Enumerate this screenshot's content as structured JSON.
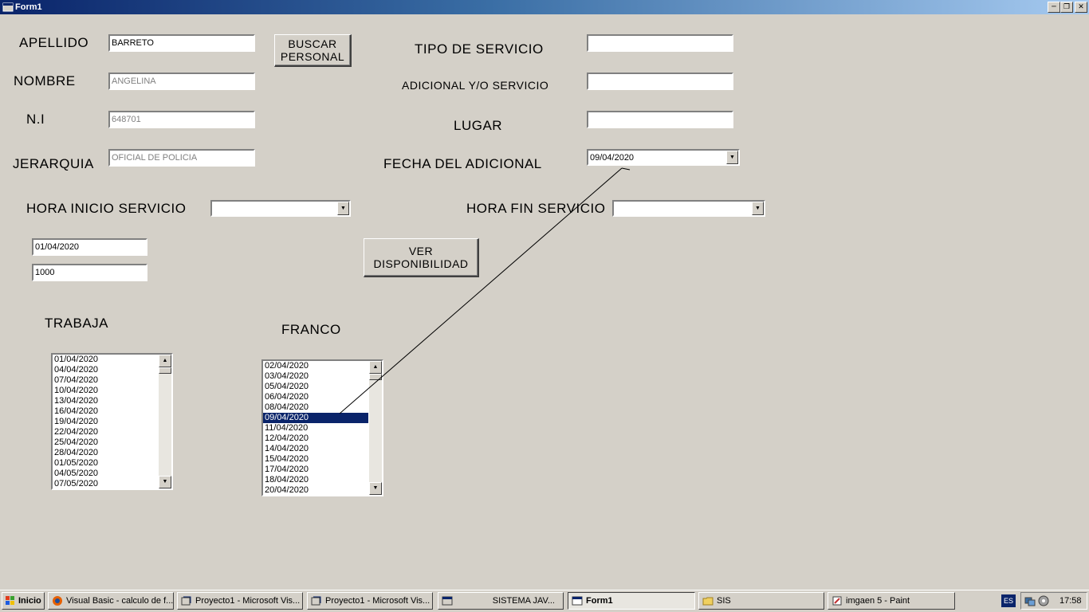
{
  "window": {
    "title": "Form1"
  },
  "form": {
    "apellido_label": "APELLIDO",
    "apellido_value": "BARRETO",
    "nombre_label": "NOMBRE",
    "nombre_value": "ANGELINA",
    "ni_label": "N.I",
    "ni_value": "648701",
    "jerarquia_label": "JERARQUIA",
    "jerarquia_value": "OFICIAL DE POLICIA",
    "buscar_button": "BUSCAR\nPERSONAL",
    "tipo_servicio_label": "TIPO DE SERVICIO",
    "tipo_servicio_value": "",
    "adicional_label": "ADICIONAL Y/O SERVICIO",
    "adicional_value": "",
    "lugar_label": "LUGAR",
    "lugar_value": "",
    "fecha_adicional_label": "FECHA DEL ADICIONAL",
    "fecha_adicional_value": "09/04/2020",
    "hora_inicio_label": "HORA INICIO SERVICIO",
    "hora_inicio_value": "",
    "hora_fin_label": "HORA FIN SERVICIO",
    "hora_fin_value": "",
    "fecha_inicio_value": "01/04/2020",
    "numero_value": "1000",
    "ver_disponibilidad_button": "VER\nDISPONIBILIDAD",
    "trabaja_label": "TRABAJA",
    "franco_label": "FRANCO"
  },
  "trabaja_list": [
    "01/04/2020",
    "04/04/2020",
    "07/04/2020",
    "10/04/2020",
    "13/04/2020",
    "16/04/2020",
    "19/04/2020",
    "22/04/2020",
    "25/04/2020",
    "28/04/2020",
    "01/05/2020",
    "04/05/2020",
    "07/05/2020"
  ],
  "franco_list": [
    "02/04/2020",
    "03/04/2020",
    "05/04/2020",
    "06/04/2020",
    "08/04/2020",
    "09/04/2020",
    "11/04/2020",
    "12/04/2020",
    "14/04/2020",
    "15/04/2020",
    "17/04/2020",
    "18/04/2020",
    "20/04/2020"
  ],
  "franco_selected_index": 5,
  "taskbar": {
    "start": "Inicio",
    "items": [
      {
        "label": "Visual Basic - calculo de f...",
        "icon": "firefox-icon"
      },
      {
        "label": "Proyecto1 - Microsoft Vis...",
        "icon": "vb-icon"
      },
      {
        "label": "Proyecto1 - Microsoft Vis...",
        "icon": "vb-icon"
      },
      {
        "label": "SISTEMA JAV...",
        "icon": "app-icon"
      },
      {
        "label": "Form1",
        "icon": "form-icon"
      },
      {
        "label": "SIS",
        "icon": "folder-icon"
      },
      {
        "label": "imgaen 5 - Paint",
        "icon": "paint-icon"
      }
    ],
    "language": "ES",
    "clock": "17:58"
  },
  "colors": {
    "selection": "#0a246a",
    "face": "#d4d0c8"
  }
}
